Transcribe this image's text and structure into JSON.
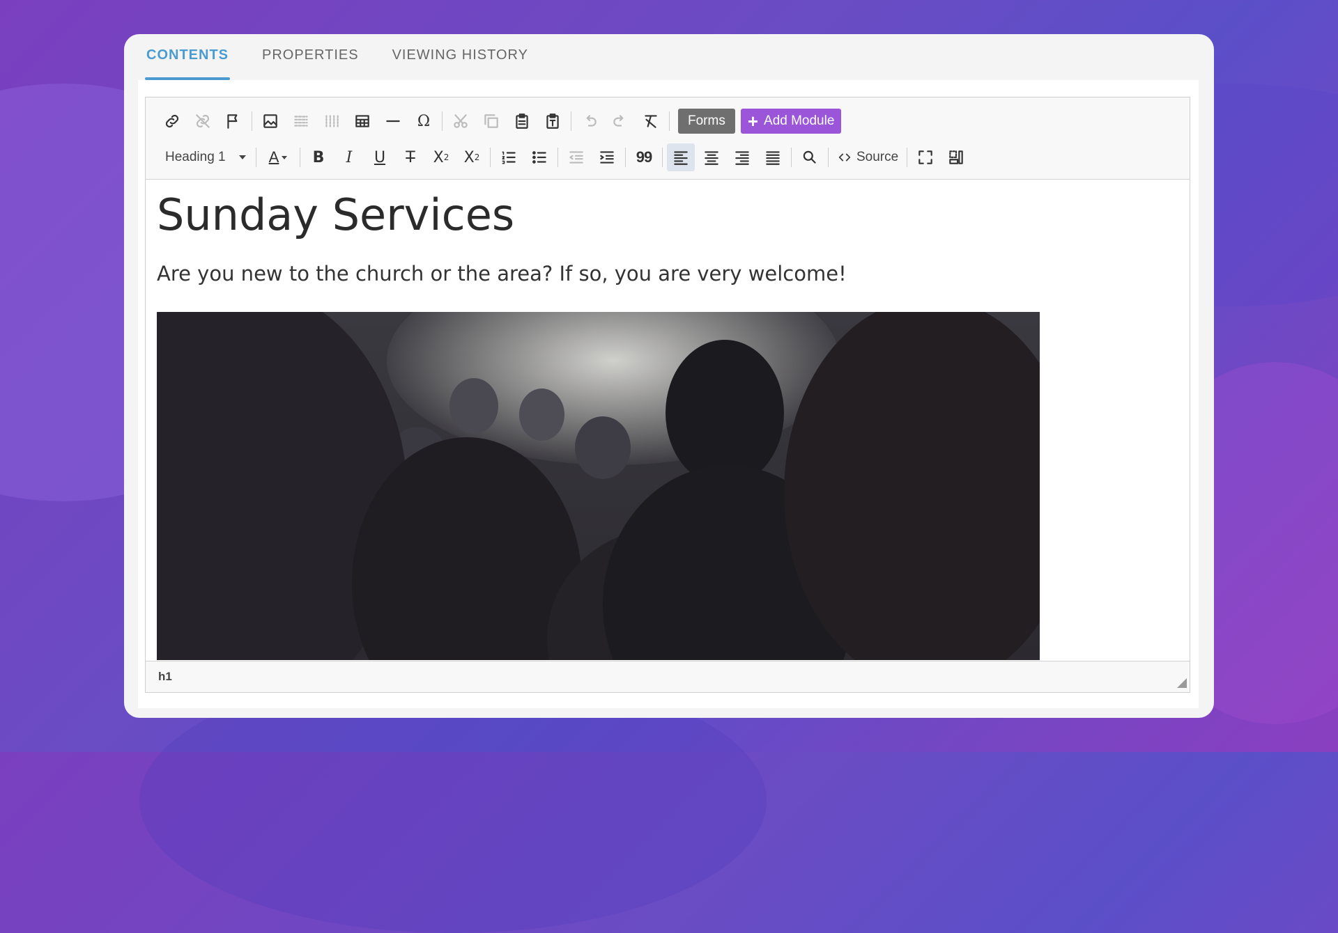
{
  "tabs": [
    {
      "label": "CONTENTS",
      "active": true
    },
    {
      "label": "PROPERTIES",
      "active": false
    },
    {
      "label": "VIEWING HISTORY",
      "active": false
    }
  ],
  "toolbar": {
    "forms_label": "Forms",
    "add_module_label": "Add Module",
    "format_value": "Heading 1",
    "source_label": "Source",
    "quote_label": "99",
    "accent_color": "#9a55d8",
    "tab_active_color": "#4a9bd0"
  },
  "document": {
    "heading": "Sunday Services",
    "paragraph": "Are you new to the church or the area? If so, you are very welcome!"
  },
  "status": {
    "element_path": "h1"
  }
}
